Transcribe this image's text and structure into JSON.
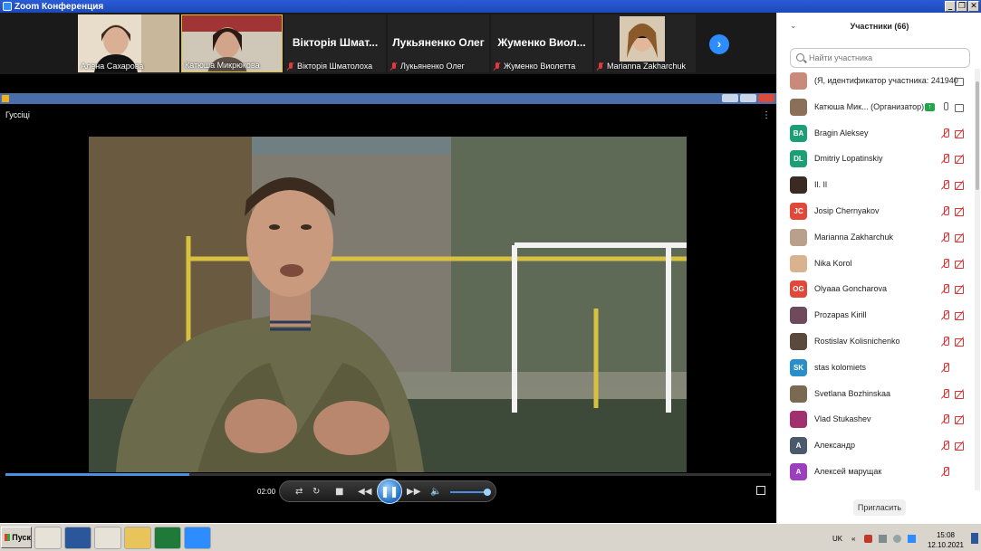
{
  "window": {
    "title": "Zoom Конференция",
    "controls": [
      "_",
      "❐",
      "✕"
    ]
  },
  "video_strip": {
    "tiles": [
      {
        "caption": "Алена Сахарова",
        "type": "video",
        "muted": false
      },
      {
        "caption": "Катюша Микрюкова",
        "type": "video",
        "muted": false,
        "active": true
      },
      {
        "big_name": "Вікторія Шмат...",
        "caption": "Вікторія Шматолоха",
        "type": "name",
        "muted": true
      },
      {
        "big_name": "Лукьяненко Олег",
        "caption": "Лукьяненко Олег",
        "type": "name",
        "muted": true
      },
      {
        "big_name": "Жуменко Виол...",
        "caption": "Жуменко Виолетта",
        "type": "name",
        "muted": true
      },
      {
        "caption": "Marianna Zakharchuk",
        "type": "video",
        "muted": true
      }
    ],
    "next_icon": "chevron-right-icon"
  },
  "player": {
    "title": "Гуссіці",
    "time": "02:00",
    "progress": 0.24,
    "volume": 0.9,
    "buttons": [
      "switch",
      "repeat",
      "stop",
      "previous",
      "pause",
      "next",
      "volume"
    ]
  },
  "participants": {
    "header": "Участники (66)",
    "search_placeholder": "Найти участника",
    "invite_label": "Пригласить",
    "list": [
      {
        "name": "(Я, идентификатор участника: 241940",
        "initials": "",
        "color": "#c98a7a",
        "photo": true,
        "mic": "none",
        "cam": "gray"
      },
      {
        "name": "Катюша Мик...  (Организатор)",
        "initials": "",
        "color": "#8a7058",
        "photo": true,
        "mic": "on",
        "cam": "gray",
        "sharing": true
      },
      {
        "name": "Bragin Aleksey",
        "initials": "BA",
        "color": "#1e9e74",
        "mic": "off",
        "cam": "off"
      },
      {
        "name": "Dmitriy Lopatinskiy",
        "initials": "DL",
        "color": "#1e9e74",
        "mic": "off",
        "cam": "off"
      },
      {
        "name": "Il. Il",
        "initials": "",
        "color": "#3a2a22",
        "photo": true,
        "mic": "off",
        "cam": "off"
      },
      {
        "name": "Josip Chernyakov",
        "initials": "JC",
        "color": "#e0493a",
        "mic": "off",
        "cam": "off"
      },
      {
        "name": "Marianna Zakharchuk",
        "initials": "",
        "color": "#b9a08a",
        "photo": true,
        "mic": "off",
        "cam": "off"
      },
      {
        "name": "Nika Korol",
        "initials": "",
        "color": "#d9b38f",
        "photo": true,
        "mic": "off",
        "cam": "off"
      },
      {
        "name": "Olyaaa Goncharova",
        "initials": "OG",
        "color": "#e0493a",
        "mic": "off",
        "cam": "off"
      },
      {
        "name": "Prozapas Kirill",
        "initials": "",
        "color": "#6e4b5c",
        "photo": true,
        "mic": "off",
        "cam": "off"
      },
      {
        "name": "Rostislav Kolisnichenko",
        "initials": "",
        "color": "#5a4a3e",
        "photo": true,
        "mic": "off",
        "cam": "off"
      },
      {
        "name": "stas kolomiets",
        "initials": "SK",
        "color": "#2a8ec8",
        "mic": "off",
        "cam": "none"
      },
      {
        "name": "Svetlana Bozhinskaa",
        "initials": "",
        "color": "#7a6a52",
        "photo": true,
        "mic": "off",
        "cam": "off"
      },
      {
        "name": "Vlad Stukashev",
        "initials": "",
        "color": "#a0306e",
        "photo": true,
        "mic": "off",
        "cam": "off"
      },
      {
        "name": "Александр",
        "initials": "A",
        "color": "#4a5a6a",
        "mic": "off",
        "cam": "off"
      },
      {
        "name": "Алексей марущак",
        "initials": "A",
        "color": "#9b3fbf",
        "mic": "off",
        "cam": "none"
      }
    ]
  },
  "taskbar": {
    "start_label": "Пуск",
    "apps": [
      {
        "icon": "chrome-icon",
        "color": "#e7e2d8"
      },
      {
        "icon": "word-icon",
        "color": "#2b579a"
      },
      {
        "icon": "opera-icon",
        "color": "#e7e2d8"
      },
      {
        "icon": "folder-icon",
        "color": "#e8c45a"
      },
      {
        "icon": "excel-icon",
        "color": "#1f7a3a"
      },
      {
        "icon": "zoom-icon",
        "color": "#2d8cff"
      }
    ],
    "lang": "UK",
    "time": "15:08",
    "date": "12.10.2021"
  }
}
